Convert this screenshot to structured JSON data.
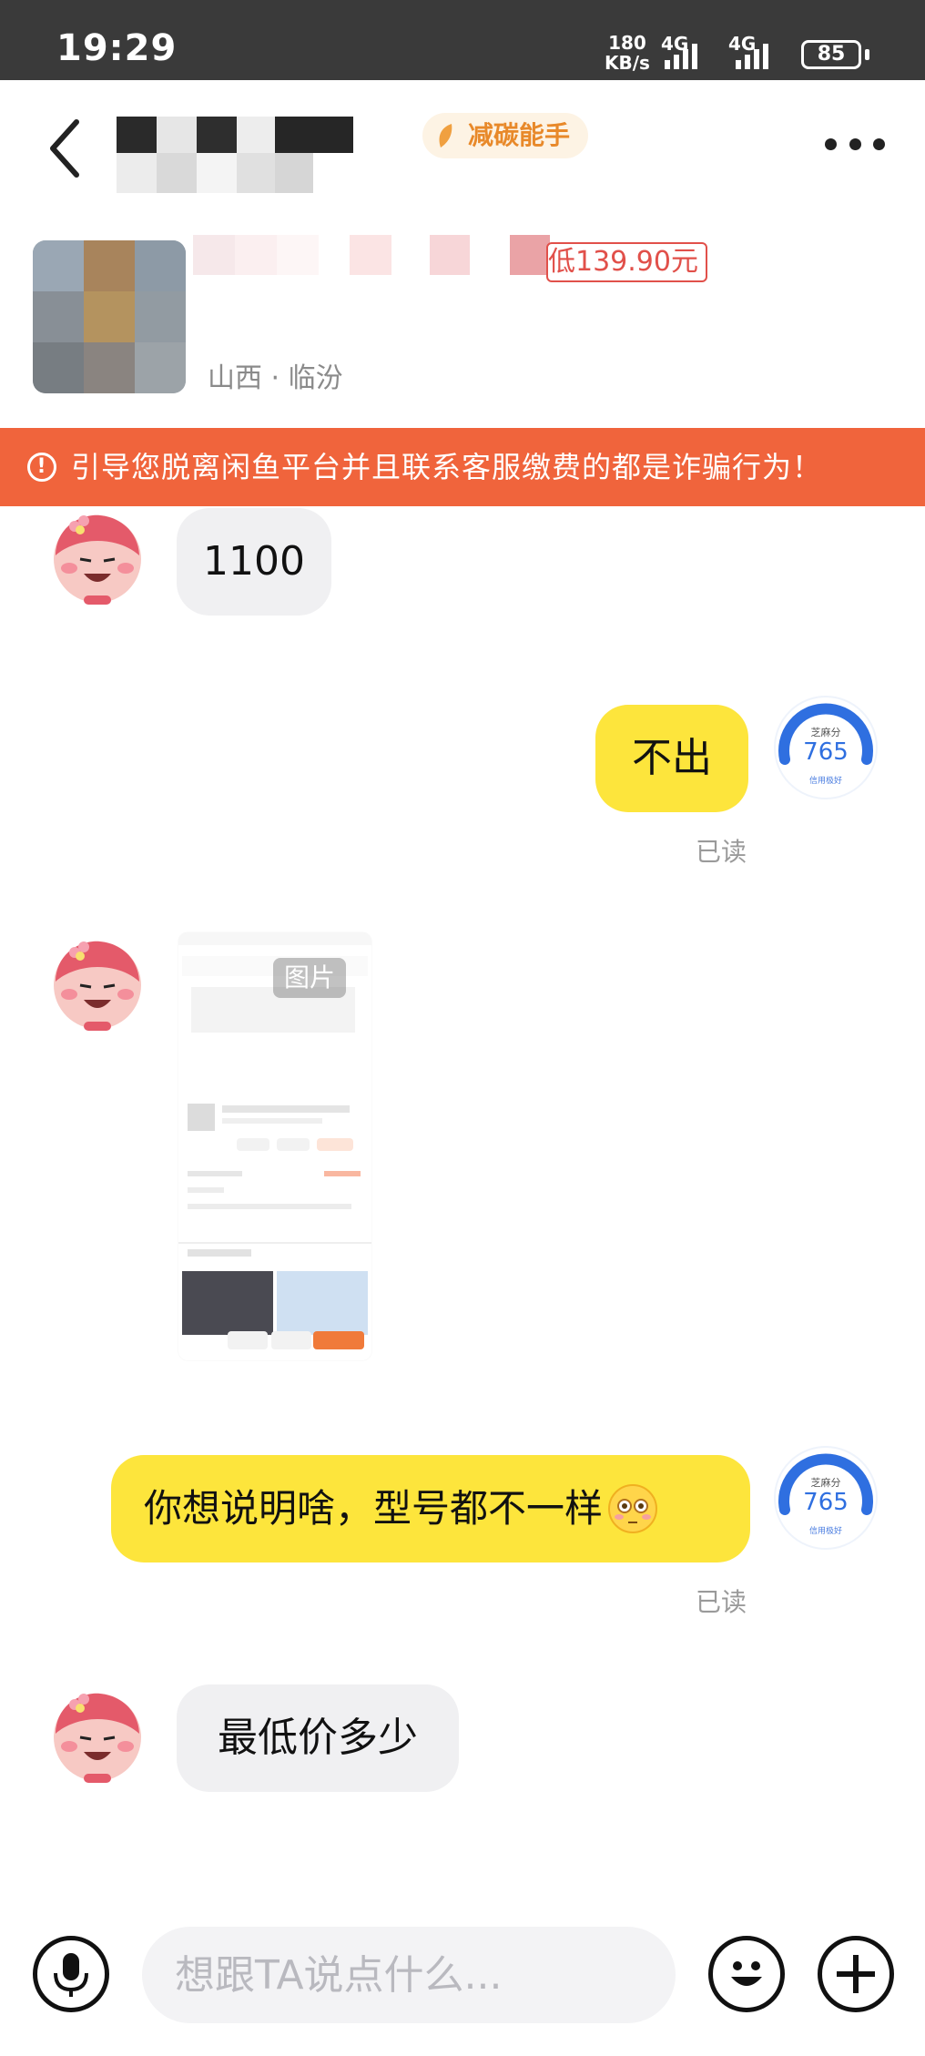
{
  "status_bar": {
    "time": "19:29",
    "speed_value": "180",
    "speed_unit": "KB/s",
    "network1": "4G",
    "network2": "4G",
    "battery": "85"
  },
  "header": {
    "badge_label": "减碳能手",
    "price_tag": "低139.90元",
    "location": "山西 · 临汾"
  },
  "warning": {
    "text": "引导您脱离闲鱼平台并且联系客服缴费的都是诈骗行为！",
    "icon": "exclamation-circle-icon"
  },
  "messages": [
    {
      "side": "in",
      "text": "1100"
    },
    {
      "side": "out",
      "text": "不出",
      "status": "已读"
    },
    {
      "side": "in",
      "type": "image",
      "label": "图片"
    },
    {
      "side": "out",
      "text": "你想说明啥，型号都不一样",
      "status": "已读"
    },
    {
      "side": "in",
      "text": "最低价多少"
    }
  ],
  "credit_badge": {
    "label": "芝麻分",
    "score": "765",
    "caption": "信用极好"
  },
  "input": {
    "placeholder": "想跟TA说点什么..."
  },
  "colors": {
    "warning_bg": "#f0643c",
    "out_bubble": "#fde53c",
    "in_bubble": "#f0f0f2",
    "badge_text": "#e8892a",
    "price_red": "#e1504a"
  }
}
